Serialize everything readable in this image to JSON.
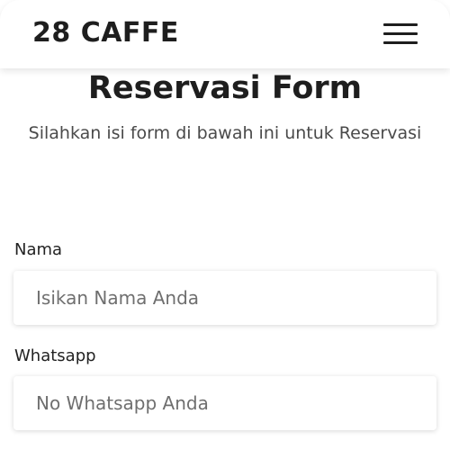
{
  "navbar": {
    "brand": "28 CAFFE",
    "menu_icon": "hamburger-menu-icon"
  },
  "header": {
    "title": "Reservasi Form",
    "subtitle": "Silahkan isi form di bawah ini untuk Reservasi"
  },
  "form": {
    "fields": [
      {
        "label": "Nama",
        "value": "",
        "placeholder": "Isikan Nama Anda"
      },
      {
        "label": "Whatsapp",
        "value": "",
        "placeholder": "No Whatsapp Anda"
      }
    ]
  }
}
